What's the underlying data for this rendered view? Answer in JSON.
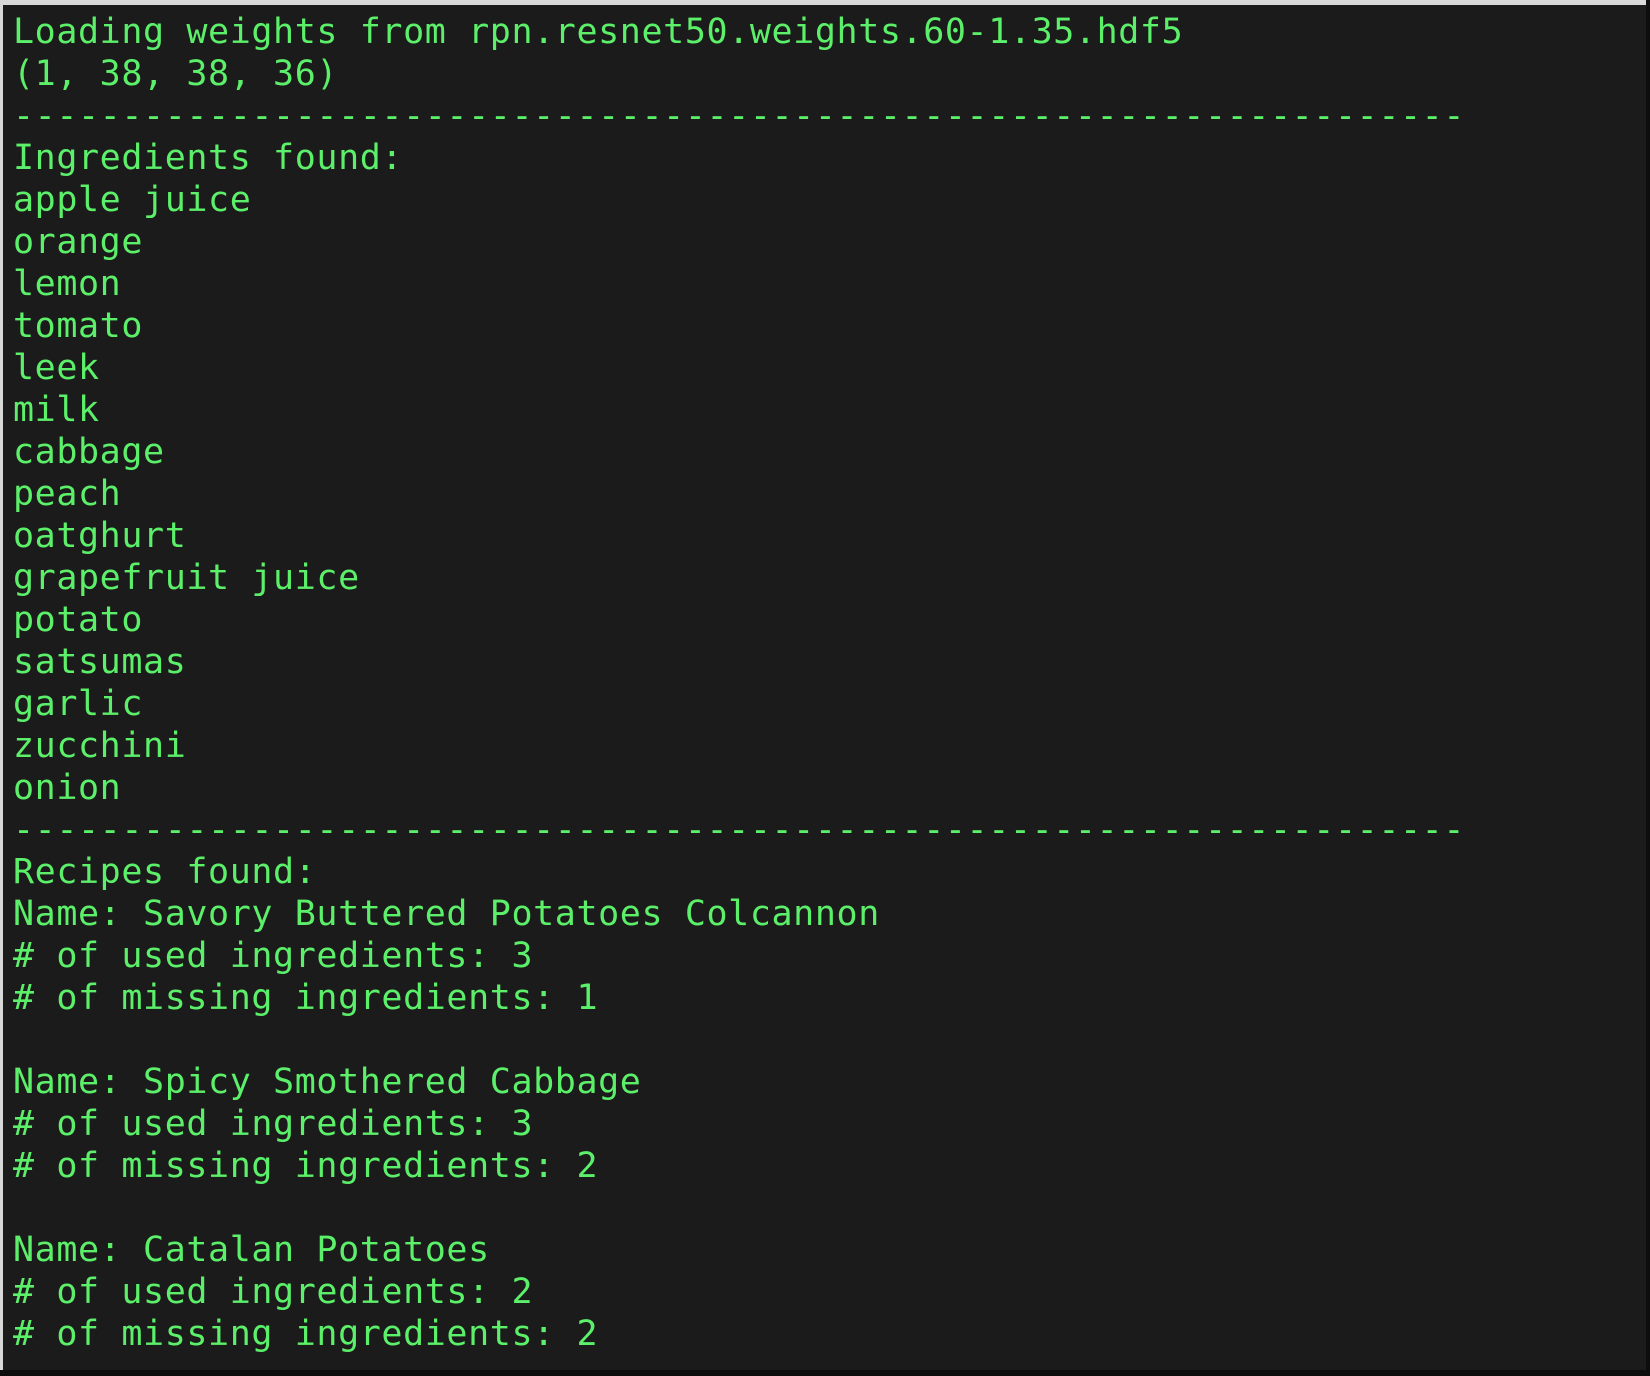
{
  "terminal": {
    "text_color": "#5cf06a",
    "background_color": "#1b1b1b",
    "loading_line": "Loading weights from rpn.resnet50.weights.60-1.35.hdf5",
    "shape_line": "(1, 38, 38, 36)",
    "separator": "-------------------------------------------------------------------",
    "ingredients_header": "Ingredients found:",
    "ingredients": [
      "apple juice",
      "orange",
      "lemon",
      "tomato",
      "leek",
      "milk",
      "cabbage",
      "peach",
      "oatghurt",
      "grapefruit juice",
      "potato",
      "satsumas",
      "garlic",
      "zucchini",
      "onion"
    ],
    "recipes_header": "Recipes found:",
    "recipes": [
      {
        "name": "Name: Savory Buttered Potatoes Colcannon",
        "used": "# of used ingredients: 3",
        "missing": "# of missing ingredients: 1"
      },
      {
        "name": "Name: Spicy Smothered Cabbage",
        "used": "# of used ingredients: 3",
        "missing": "# of missing ingredients: 2"
      },
      {
        "name": "Name: Catalan Potatoes",
        "used": "# of used ingredients: 2",
        "missing": "# of missing ingredients: 2"
      }
    ]
  }
}
